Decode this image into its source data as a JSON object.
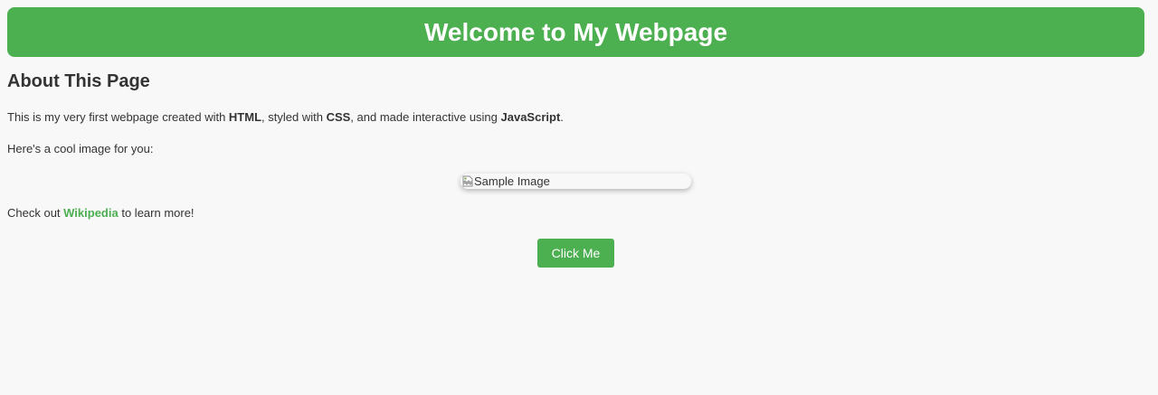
{
  "header": {
    "title": "Welcome to My Webpage"
  },
  "about": {
    "heading": "About This Page",
    "intro": {
      "part1": "This is my very first webpage created with ",
      "html": "HTML",
      "part2": ", styled with ",
      "css": "CSS",
      "part3": ", and made interactive using ",
      "js": "JavaScript",
      "part4": "."
    },
    "image_intro": "Here's a cool image for you:",
    "image_alt": "Sample Image",
    "checkout": {
      "before": "Check out ",
      "link_text": "Wikipedia",
      "after": " to learn more!"
    }
  },
  "button": {
    "label": "Click Me"
  },
  "colors": {
    "accent": "#4caf50",
    "background": "#f8f8f8",
    "text": "#333333"
  },
  "icons": {
    "image_placeholder": "broken-image-icon"
  }
}
